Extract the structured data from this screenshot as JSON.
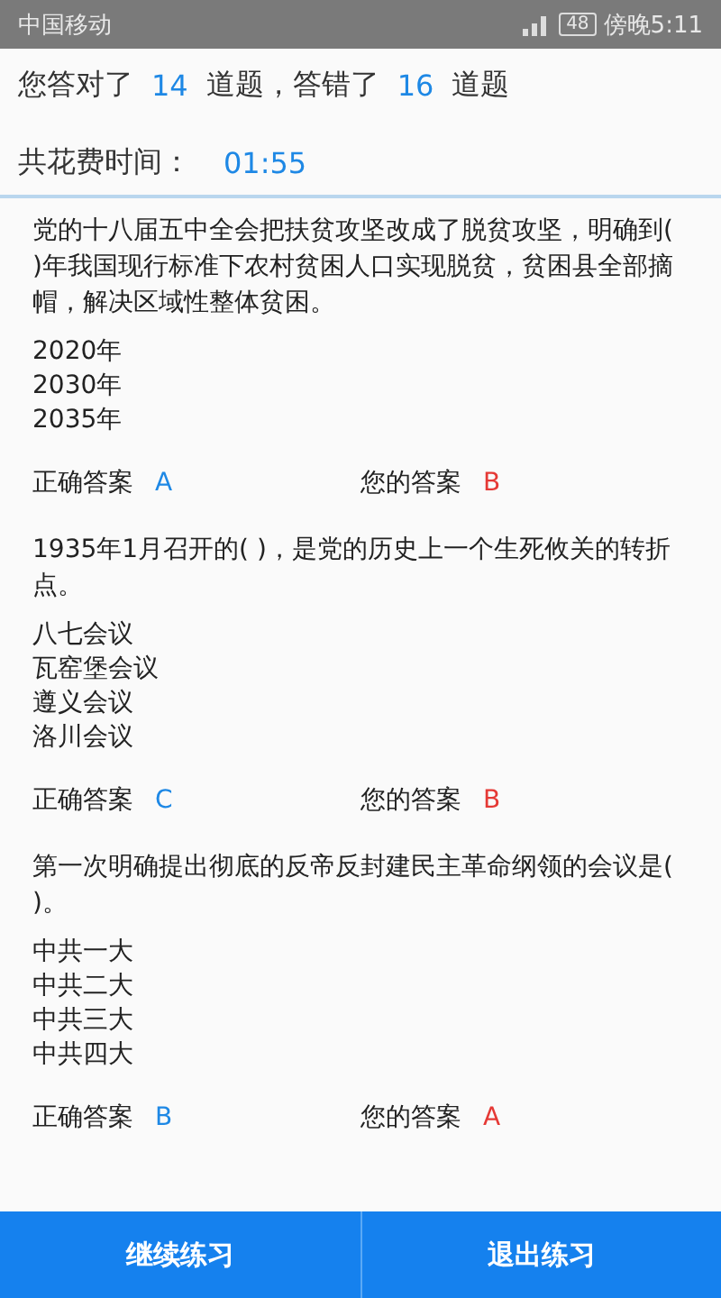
{
  "status_bar": {
    "carrier": "中国移动",
    "time": "傍晚5:11",
    "battery": "48"
  },
  "summary": {
    "correct_prefix": "您答对了",
    "correct_count": "14",
    "middle": "道题，答错了",
    "wrong_count": "16",
    "suffix": "道题"
  },
  "time_spent": {
    "label": "共花费时间：",
    "value": "01:55"
  },
  "questions": [
    {
      "text": "党的十八届五中全会把扶贫攻坚改成了脱贫攻坚，明确到( )年我国现行标准下农村贫困人口实现脱贫，贫困县全部摘帽，解决区域性整体贫困。",
      "options": [
        "2020年",
        "2030年",
        "2035年"
      ],
      "correct_label": "正确答案",
      "correct": "A",
      "yours_label": "您的答案",
      "yours": "B"
    },
    {
      "text": "1935年1月召开的( )，是党的历史上一个生死攸关的转折点。",
      "options": [
        "八七会议",
        "瓦窑堡会议",
        "遵义会议",
        "洛川会议"
      ],
      "correct_label": "正确答案",
      "correct": "C",
      "yours_label": "您的答案",
      "yours": "B"
    },
    {
      "text": "第一次明确提出彻底的反帝反封建民主革命纲领的会议是( )。",
      "options": [
        "中共一大",
        "中共二大",
        "中共三大",
        "中共四大"
      ],
      "correct_label": "正确答案",
      "correct": "B",
      "yours_label": "您的答案",
      "yours": "A"
    }
  ],
  "buttons": [
    "继续练习",
    "退出练习"
  ]
}
